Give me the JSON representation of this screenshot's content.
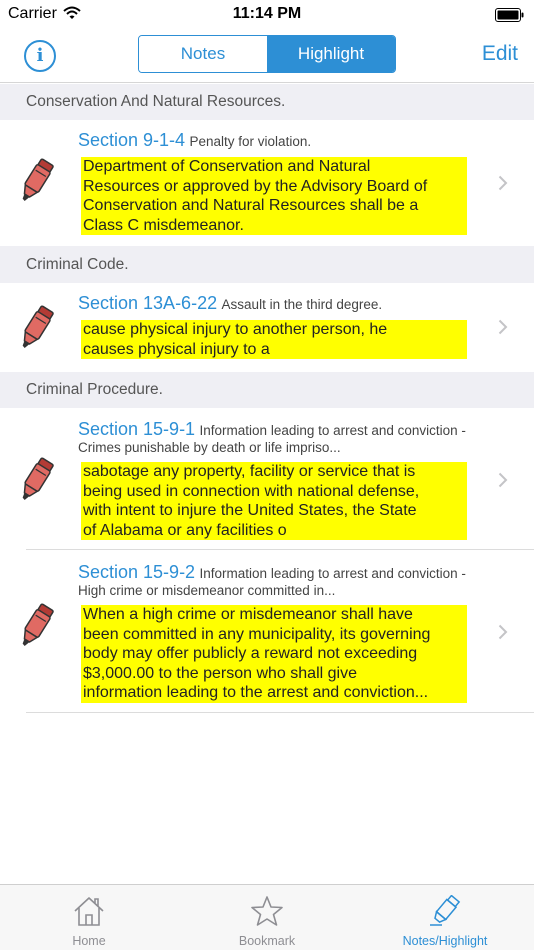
{
  "status_bar": {
    "carrier": "Carrier",
    "time": "11:14 PM"
  },
  "nav": {
    "info_label": "i",
    "segments": [
      "Notes",
      "Highlight"
    ],
    "selected_segment": "Highlight",
    "edit_label": "Edit"
  },
  "sections": [
    {
      "header": "Conservation And Natural Resources.",
      "items": [
        {
          "section": "Section 9-1-4",
          "title": "Penalty for violation.",
          "highlight_lines": [
            "Department of Conservation and Natural",
            "Resources or approved by the Advisory Board of",
            "Conservation and Natural Resources shall be a",
            "Class C misdemeanor."
          ]
        }
      ]
    },
    {
      "header": "Criminal Code.",
      "items": [
        {
          "section": "Section 13A-6-22",
          "title": "Assault in the third degree.",
          "highlight_lines": [
            "cause physical injury to another person, he",
            "causes physical injury to a"
          ]
        }
      ]
    },
    {
      "header": "Criminal Procedure.",
      "items": [
        {
          "section": "Section 15-9-1",
          "title": "Information leading to arrest and conviction - Crimes punishable by death or life impriso...",
          "highlight_lines": [
            "sabotage any property, facility or service that is",
            "being used in connection with national defense,",
            "with intent to injure the United States, the State",
            "of Alabama or any facilities o"
          ]
        },
        {
          "section": "Section 15-9-2",
          "title": "Information leading to arrest and conviction - High crime or misdemeanor committed in...",
          "highlight_lines": [
            "When a high crime or misdemeanor shall have",
            "been committed in any municipality, its governing",
            "body may offer publicly a reward not exceeding",
            "$3,000.00 to the person who shall give",
            "information leading to the arrest and conviction..."
          ]
        }
      ]
    }
  ],
  "tab_bar": {
    "tabs": [
      {
        "label": "Home",
        "icon": "home-icon"
      },
      {
        "label": "Bookmark",
        "icon": "star-icon"
      },
      {
        "label": "Notes/Highlight",
        "icon": "highlighter-icon"
      }
    ],
    "selected_tab": "Notes/Highlight"
  },
  "colors": {
    "accent": "#2d8fd5",
    "highlight": "#ffff00",
    "marker": "#d9534f",
    "section_header_bg": "#efeff4"
  }
}
